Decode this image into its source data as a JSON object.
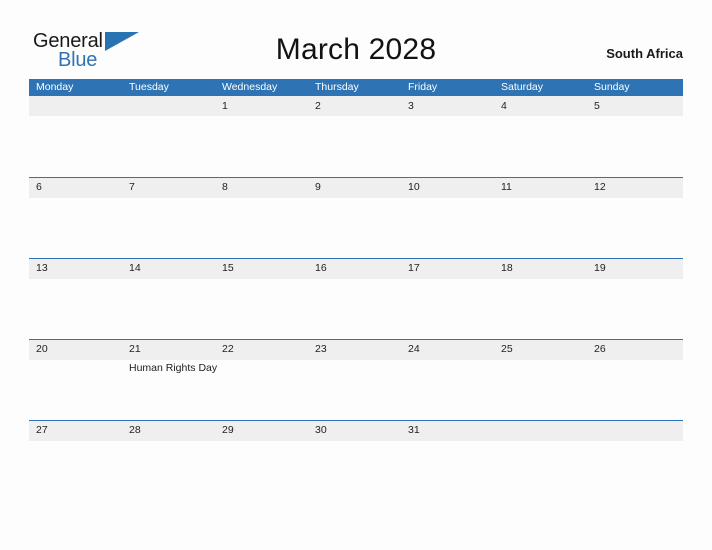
{
  "brand": {
    "name_part1": "General",
    "name_part2": "Blue",
    "flag_icon": "blue-triangle-flag-icon",
    "accent_color": "#2e74b5"
  },
  "header": {
    "title": "March 2028",
    "region": "South Africa"
  },
  "calendar": {
    "month": "March",
    "year": "2028",
    "header_background": "#2e74b5",
    "band_background": "#efefef",
    "weekdays": [
      "Monday",
      "Tuesday",
      "Wednesday",
      "Thursday",
      "Friday",
      "Saturday",
      "Sunday"
    ],
    "weeks": [
      [
        {
          "date": "",
          "events": ""
        },
        {
          "date": "",
          "events": ""
        },
        {
          "date": "1",
          "events": ""
        },
        {
          "date": "2",
          "events": ""
        },
        {
          "date": "3",
          "events": ""
        },
        {
          "date": "4",
          "events": ""
        },
        {
          "date": "5",
          "events": ""
        }
      ],
      [
        {
          "date": "6",
          "events": ""
        },
        {
          "date": "7",
          "events": ""
        },
        {
          "date": "8",
          "events": ""
        },
        {
          "date": "9",
          "events": ""
        },
        {
          "date": "10",
          "events": ""
        },
        {
          "date": "11",
          "events": ""
        },
        {
          "date": "12",
          "events": ""
        }
      ],
      [
        {
          "date": "13",
          "events": ""
        },
        {
          "date": "14",
          "events": ""
        },
        {
          "date": "15",
          "events": ""
        },
        {
          "date": "16",
          "events": ""
        },
        {
          "date": "17",
          "events": ""
        },
        {
          "date": "18",
          "events": ""
        },
        {
          "date": "19",
          "events": ""
        }
      ],
      [
        {
          "date": "20",
          "events": ""
        },
        {
          "date": "21",
          "events": "Human Rights Day"
        },
        {
          "date": "22",
          "events": ""
        },
        {
          "date": "23",
          "events": ""
        },
        {
          "date": "24",
          "events": ""
        },
        {
          "date": "25",
          "events": ""
        },
        {
          "date": "26",
          "events": ""
        }
      ],
      [
        {
          "date": "27",
          "events": ""
        },
        {
          "date": "28",
          "events": ""
        },
        {
          "date": "29",
          "events": ""
        },
        {
          "date": "30",
          "events": ""
        },
        {
          "date": "31",
          "events": ""
        },
        {
          "date": "",
          "events": ""
        },
        {
          "date": "",
          "events": ""
        }
      ]
    ]
  }
}
